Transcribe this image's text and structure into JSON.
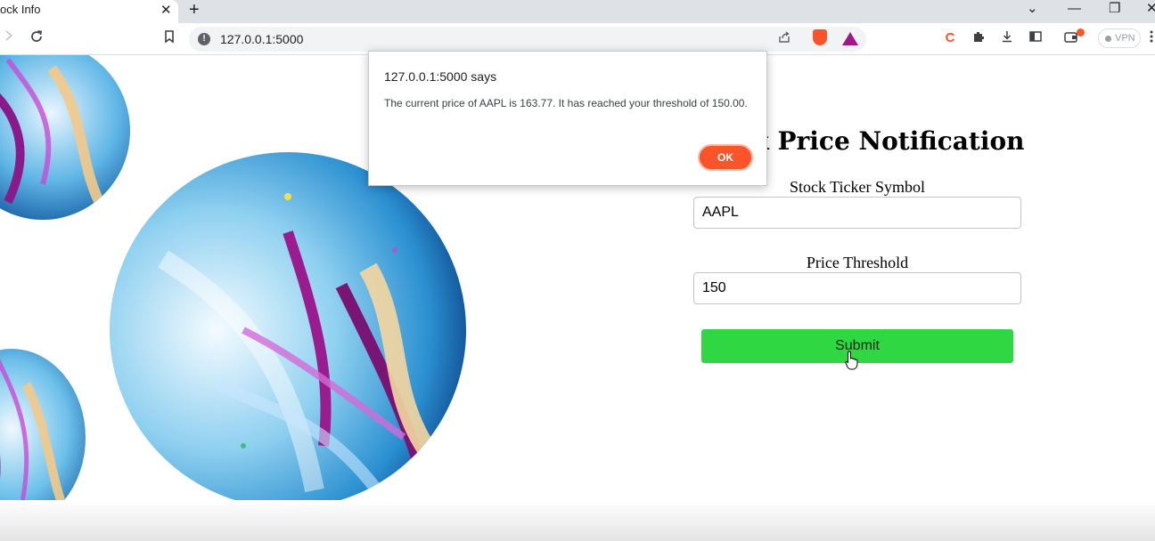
{
  "browser": {
    "tab_title": "ock Info",
    "tab_close": "✕",
    "new_tab": "+",
    "url": "127.0.0.1:5000",
    "vpn_label": "VPN",
    "accent_color": "#fb542b",
    "controls": {
      "chevron": "⌄",
      "minimize": "—",
      "restore": "❐",
      "close": "✕"
    },
    "icons": [
      "forward-icon",
      "reload-icon",
      "bookmark-icon",
      "site-info-icon",
      "share-icon",
      "brave-shields-icon",
      "brave-rewards-icon",
      "extension-c-icon",
      "puzzle-extensions-icon",
      "download-icon",
      "sidebar-icon",
      "wallet-icon",
      "menu-icon"
    ]
  },
  "page": {
    "title": "Stock Price Notification",
    "ticker_label": "Stock Ticker Symbol",
    "ticker_value": "AAPL",
    "threshold_label": "Price Threshold",
    "threshold_value": "150",
    "submit_label": "Submit",
    "submit_color": "#2fd742"
  },
  "alert": {
    "origin": "127.0.0.1:5000 says",
    "message": "The current price of AAPL is 163.77. It has reached your threshold of 150.00.",
    "ok_label": "OK"
  }
}
